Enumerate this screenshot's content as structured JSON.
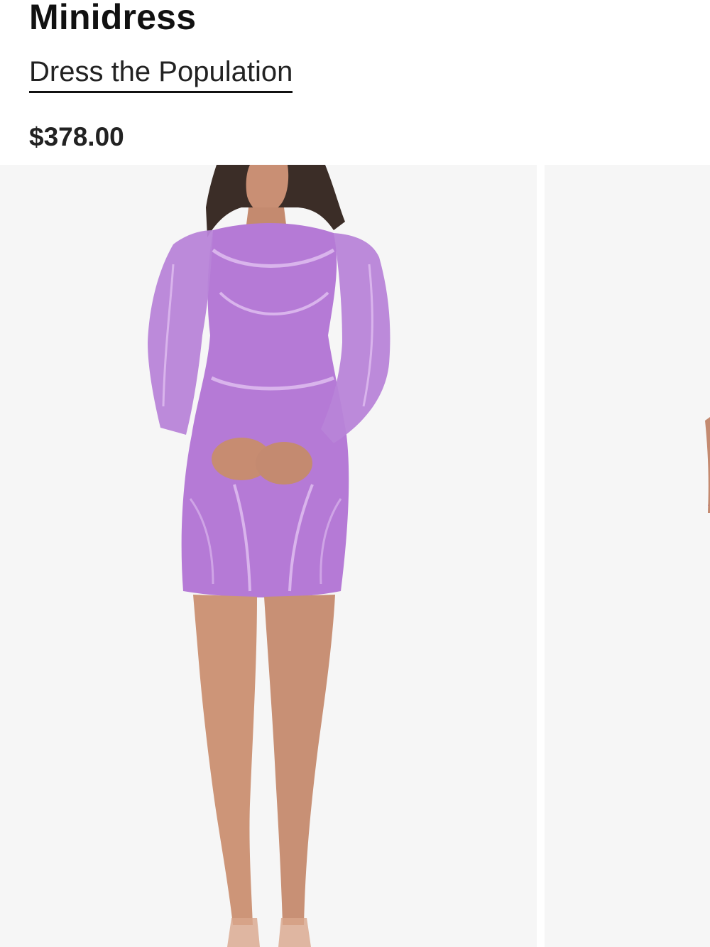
{
  "product": {
    "title": "Minidress",
    "brand": "Dress the Population",
    "price": "$378.00"
  },
  "gallery": {
    "images": [
      {
        "alt": "Purple beaded long-sleeve minidress, front view"
      },
      {
        "alt": "Purple beaded long-sleeve minidress, alternate view"
      }
    ]
  },
  "colors": {
    "dress": "#b57ad6",
    "background": "#f6f6f6",
    "text": "#111111"
  }
}
